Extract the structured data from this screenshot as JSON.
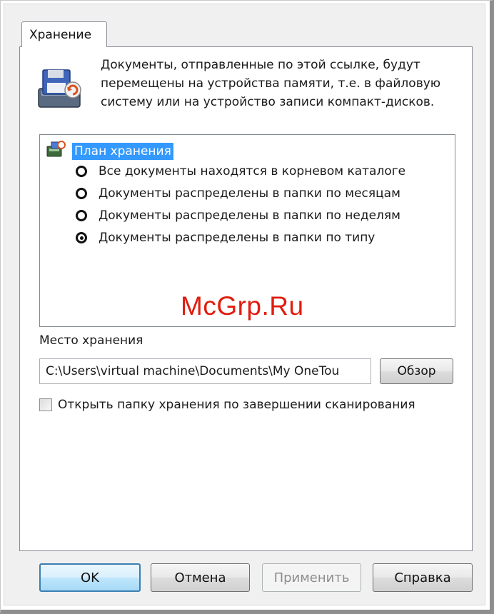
{
  "tab": {
    "label": "Хранение"
  },
  "description": "Документы, отправленные по этой ссылке, будут перемещены на устройства памяти, т.е. в файловую систему или на устройство записи компакт-дисков.",
  "tree": {
    "root_label": "План хранения",
    "options": [
      {
        "label": "Все документы находятся в корневом каталоге",
        "checked": false
      },
      {
        "label": "Документы распределены в папки по месяцам",
        "checked": false
      },
      {
        "label": "Документы распределены в папки по неделям",
        "checked": false
      },
      {
        "label": "Документы распределены в папки по типу",
        "checked": true
      }
    ]
  },
  "location": {
    "label": "Место хранения",
    "path": "C:\\Users\\virtual machine\\Documents\\My OneTou",
    "browse_label": "Обзор"
  },
  "open_folder": {
    "label": "Открыть папку хранения по завершении сканирования",
    "checked": false
  },
  "buttons": {
    "ok": "OK",
    "cancel": "Отмена",
    "apply": "Применить",
    "help": "Справка"
  },
  "watermark": "McGrp.Ru",
  "colors": {
    "selection": "#3399ff",
    "watermark": "#e01d0f"
  }
}
